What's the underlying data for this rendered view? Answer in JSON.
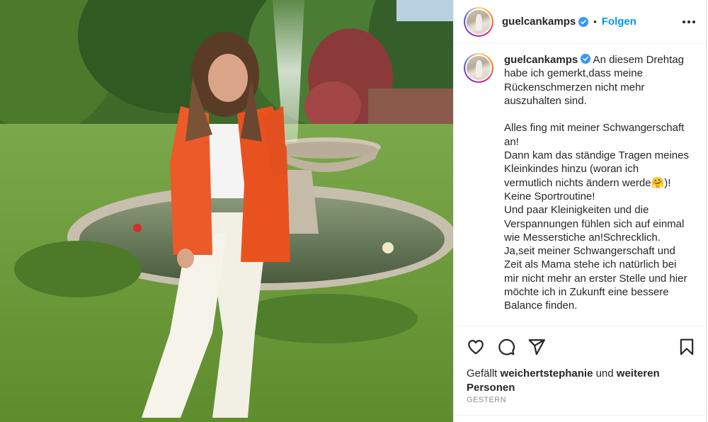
{
  "post": {
    "username": "guelcankamps",
    "follow_label": "Folgen",
    "separator": "•"
  },
  "caption": {
    "username": "guelcankamps",
    "text": " An diesem Drehtag habe ich gemerkt,dass meine Rückenschmerzen nicht mehr auszuhalten sind.\n\nAlles fing mit meiner Schwangerschaft an!\nDann kam das ständige Tragen meines Kleinkindes hinzu (woran ich vermutlich nichts ändern werde🤗)!\nKeine Sportroutine!\nUnd paar Kleinigkeiten und die Verspannungen fühlen sich auf einmal wie Messerstiche an!Schrecklich.\nJa,seit meiner Schwangerschaft und Zeit als Mama stehe ich natürlich bei mir nicht mehr an erster Stelle und hier möchte ich in Zukunft eine bessere Balance finden."
  },
  "likes": {
    "prefix": "Gefällt ",
    "user": "weichertstephanie",
    "middle": " und ",
    "others": "weiteren Personen"
  },
  "timestamp": "GESTERN",
  "icons": {
    "verified": "verified-badge-icon",
    "like": "heart-icon",
    "comment": "comment-icon",
    "share": "paper-plane-icon",
    "save": "bookmark-icon",
    "more": "more-options-icon"
  },
  "colors": {
    "link_blue": "#0095f6",
    "verified_blue": "#3897f0",
    "text": "#262626",
    "muted": "#8e8e8e",
    "blazer": "#ec5a2a"
  }
}
